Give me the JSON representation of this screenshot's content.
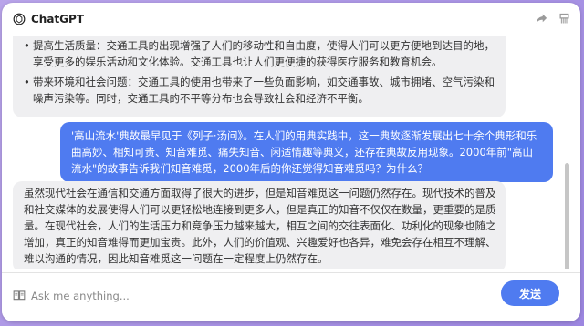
{
  "app": {
    "title": "ChatGPT"
  },
  "header_icons": [
    "share-icon",
    "brush-icon"
  ],
  "messages": [
    {
      "role": "assistant",
      "bullets": [
        "提高生活质量：交通工具的出现增强了人们的移动性和自由度，使得人们可以更方便地到达目的地，享受更多的娱乐活动和文化体验。交通工具也让人们更便捷的获得医疗服务和教育机会。",
        "带来环境和社会问题：交通工具的使用也带来了一些负面影响，如交通事故、城市拥堵、空气污染和噪声污染等。同时，交通工具的不平等分布也会导致社会和经济不平衡。"
      ]
    },
    {
      "role": "user",
      "text": "'高山流水'典故最早见于《列子·汤问》。在人们的用典实践中，这一典故逐渐发展出七十余个典形和乐曲高妙、相知可贵、知音难觅、痛失知音、闲适情趣等典义，还存在典故反用现象。2000年前\"高山流水\"的故事告诉我们知音难觅，2000年后的你还觉得知音难觅吗？为什么？"
    },
    {
      "role": "assistant",
      "text": "虽然现代社会在通信和交通方面取得了很大的进步，但是知音难觅这一问题仍然存在。现代技术的普及和社交媒体的发展使得人们可以更轻松地连接到更多人，但是真正的知音不仅仅在数量，更重要的是质量。在现代社会，人们的生活压力和竞争压力越来越大，相互之间的交往表面化、功利化的现象也随之增加，真正的知音难得而更加宝贵。此外，人们的价值观、兴趣爱好也各异，难免会存在相互不理解、难以沟通的情况，因此知音难觅这一问题在一定程度上仍然存在。"
    }
  ],
  "input": {
    "placeholder": "Ask me anything...",
    "value": ""
  },
  "send_label": "发送",
  "colors": {
    "accent": "#4f7bf0",
    "background": "#a892e6",
    "assistant_bubble": "#efeff1"
  }
}
